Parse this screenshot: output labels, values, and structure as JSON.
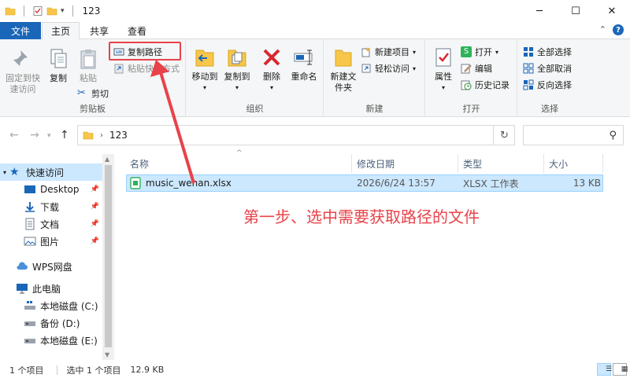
{
  "window": {
    "title": "123",
    "minimize": "─",
    "maximize": "☐",
    "close": "✕"
  },
  "tabs": {
    "file": "文件",
    "home": "主页",
    "share": "共享",
    "view": "查看"
  },
  "ribbon": {
    "clipboard": {
      "label": "剪贴板",
      "pin": "固定到快速访问",
      "copy": "复制",
      "paste": "粘贴",
      "copy_path": "复制路径",
      "paste_shortcut": "粘贴快捷方式",
      "cut": "剪切"
    },
    "organize": {
      "label": "组织",
      "move_to": "移动到",
      "copy_to": "复制到",
      "delete": "删除",
      "rename": "重命名"
    },
    "new": {
      "label": "新建",
      "new_folder": "新建文件夹",
      "new_item": "新建项目",
      "easy_access": "轻松访问"
    },
    "open": {
      "label": "打开",
      "properties": "属性",
      "open": "打开",
      "edit": "编辑",
      "history": "历史记录"
    },
    "select": {
      "label": "选择",
      "select_all": "全部选择",
      "select_none": "全部取消",
      "invert": "反向选择"
    }
  },
  "address": {
    "path": "123"
  },
  "nav": {
    "quick_access": "快速访问",
    "desktop": "Desktop",
    "downloads": "下载",
    "documents": "文档",
    "pictures": "图片",
    "wps": "WPS网盘",
    "this_pc": "此电脑",
    "drive_c": "本地磁盘 (C:)",
    "drive_d": "备份 (D:)",
    "drive_e": "本地磁盘 (E:)"
  },
  "columns": {
    "name": "名称",
    "date": "修改日期",
    "type": "类型",
    "size": "大小"
  },
  "files": [
    {
      "name": "music_wenan.xlsx",
      "date": "2026/6/24 13:57",
      "type": "XLSX 工作表",
      "size": "13 KB"
    }
  ],
  "annotation": "第一步、选中需要获取路径的文件",
  "status": {
    "count": "1 个项目",
    "selected": "选中 1 个项目",
    "size": "12.9 KB"
  },
  "colors": {
    "accent": "#1a66b8",
    "highlight": "#e8434a",
    "selection": "#cce8ff"
  }
}
